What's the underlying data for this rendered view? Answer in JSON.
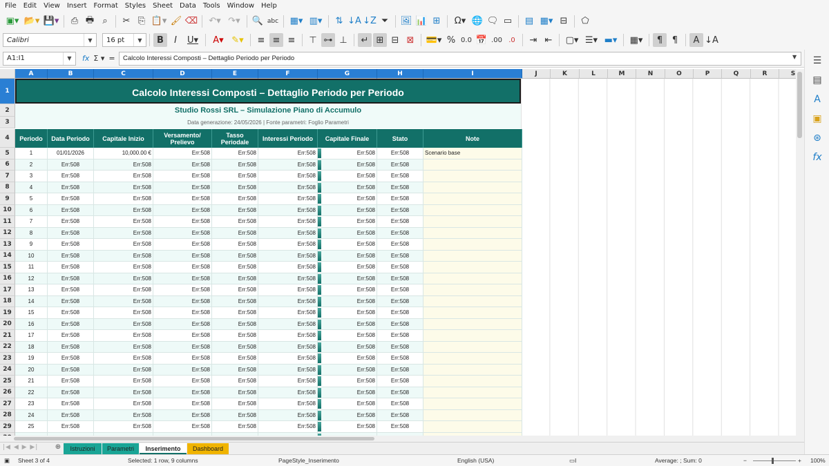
{
  "menu": [
    "File",
    "Edit",
    "View",
    "Insert",
    "Format",
    "Styles",
    "Sheet",
    "Data",
    "Tools",
    "Window",
    "Help"
  ],
  "toolbar2": {
    "font": "Calibri",
    "size": "16 pt"
  },
  "formula_bar": {
    "name_box": "A1:I1",
    "formula": "Calcolo Interessi Composti – Dettaglio Periodo per Periodo"
  },
  "columns": [
    "A",
    "B",
    "C",
    "D",
    "E",
    "F",
    "G",
    "H",
    "I",
    "J",
    "K",
    "L",
    "M",
    "N",
    "O",
    "P",
    "Q",
    "R",
    "S"
  ],
  "sheet": {
    "title": "Calcolo Interessi Composti – Dettaglio Periodo per Periodo",
    "subtitle": "Studio Rossi SRL – Simulazione Piano di Accumulo",
    "meta": "Data generazione: 24/05/2026  |  Fonte parametri: Foglio Parametri",
    "headers": [
      "Periodo",
      "Data Periodo",
      "Capitale Inizio",
      "Versamento/ Prelievo",
      "Tasso Periodale",
      "Interessi Periodo",
      "Capitale Finale",
      "Stato",
      "Note"
    ],
    "first_row": {
      "periodo": "1",
      "data": "01/01/2026",
      "capitale": "10,000.00 €",
      "err": "Err:508",
      "note": "Scenario base"
    },
    "err": "Err:508",
    "rows_count": 25
  },
  "tabs": [
    {
      "label": "Istruzioni",
      "color": "#1aa596"
    },
    {
      "label": "Parametri",
      "color": "#1aa596"
    },
    {
      "label": "Inserimento",
      "color": "#ffffff"
    },
    {
      "label": "Dashboard",
      "color": "#f0b400"
    }
  ],
  "status": {
    "sheet": "Sheet 3 of 4",
    "selection": "Selected: 1 row, 9 columns",
    "page_style": "PageStyle_Inserimento",
    "language": "English (USA)",
    "sum": "Average: ; Sum: 0",
    "zoom": "100%"
  }
}
